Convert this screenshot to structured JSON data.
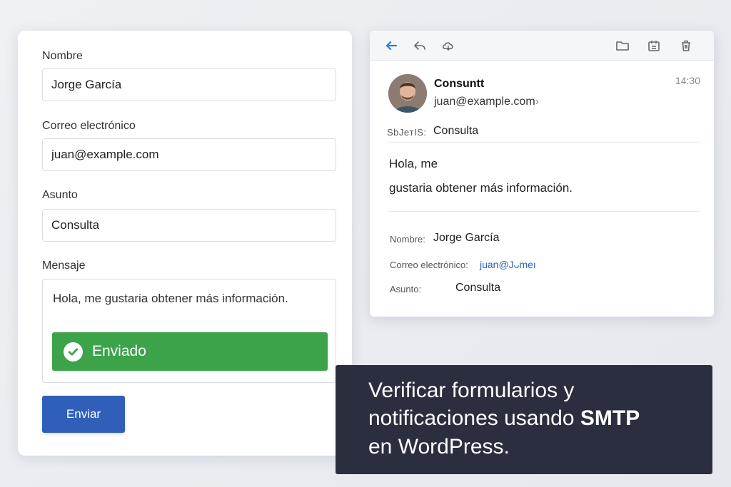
{
  "form": {
    "name_label": "Nombre",
    "name_value": "Jorge García",
    "email_label": "Correo electrónico",
    "email_value": "juan@example.com",
    "subject_label": "Asunto",
    "subject_value": "Consulta",
    "message_label": "Mensaje",
    "message_value": "Hola, me gustaria obtener más información.",
    "sent_label": "Enviado",
    "submit_label": "Enviar"
  },
  "email": {
    "sender_name": "Consuntt",
    "sender_email": "juan@example.com",
    "sender_email_suffix": "›",
    "time": "14:30",
    "subject_label": "SbJeтIS:",
    "subject_value": "Consulta",
    "body_line1": "Hola, me",
    "body_line2": "gustaria obtener más información.",
    "meta_name_label": "Nombre:",
    "meta_name_value": "Jorge García",
    "meta_email_label": "Correo electrónico:",
    "meta_email_value": "juan@Jᴗmeı",
    "meta_subject_label": "Asunto:",
    "meta_subject_value": "Consulta"
  },
  "caption": {
    "line1": "Verificar formularios y",
    "line2_prefix": "notificaciones usando ",
    "line2_bold": "SMTP",
    "line3": "en WordPress."
  },
  "colors": {
    "success": "#3da34a",
    "primary": "#2f5fb8",
    "caption_bg": "#2b2e3e",
    "link": "#2a63c5"
  }
}
